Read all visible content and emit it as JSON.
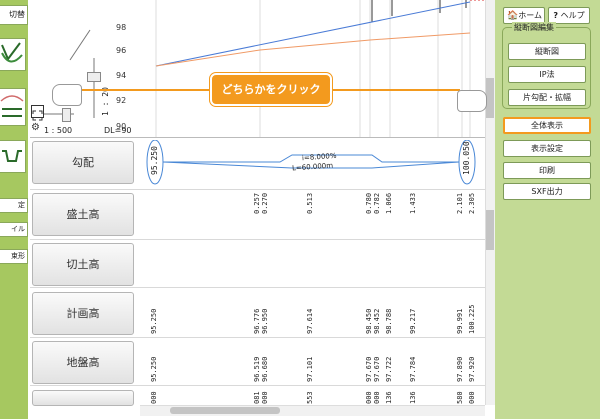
{
  "left_toolbar": {
    "top_button": "切替",
    "side_buttons": [
      "定",
      "イル",
      "束形"
    ]
  },
  "profile": {
    "y_ticks": [
      "98",
      "96",
      "94",
      "92",
      "90"
    ],
    "scale_label": "1 : 500",
    "vscale_label": "1 : 20",
    "dl_label": "DL=90"
  },
  "callout": {
    "text": "どちらかをクリック"
  },
  "right_panel": {
    "home_button": "ホーム",
    "help_button": "ヘルプ",
    "group_label": "縦断図編集",
    "group_buttons": [
      "縦断図",
      "IP法",
      "片勾配・拡幅"
    ],
    "fit_button": "全体表示",
    "display_settings_button": "表示設定",
    "print_button": "印刷",
    "sxf_button": "SXF出力"
  },
  "rows": [
    {
      "label": "勾配"
    },
    {
      "label": "盛土高"
    },
    {
      "label": "切土高"
    },
    {
      "label": "計画高"
    },
    {
      "label": "地盤高"
    }
  ],
  "gradient": {
    "start": "95.250",
    "end": "100.050",
    "slope": "i=8.000%",
    "length": "L=60.000m"
  },
  "fill_values": [
    "0.257",
    "0.270",
    "0.513",
    "0.780",
    "0.782",
    "1.066",
    "1.433",
    "2.101",
    "2.305"
  ],
  "plan_values": [
    "95.250",
    "96.776",
    "96.950",
    "97.614",
    "98.450",
    "98.452",
    "98.788",
    "99.217",
    "99.991",
    "100.225"
  ],
  "ground_values": [
    "95.250",
    "96.519",
    "96.680",
    "97.101",
    "97.670",
    "97.670",
    "97.722",
    "97.784",
    "97.890",
    "97.920"
  ],
  "station_values": [
    "000",
    "081",
    "000",
    "553",
    "000",
    "000",
    "136",
    "136",
    "580",
    "000"
  ],
  "colors": {
    "left_green": "#a6c860",
    "right_green": "#c3da95",
    "callout_orange": "#f39a1e",
    "plan_line": "#4a7bd6",
    "ground_line": "#f09a66"
  }
}
